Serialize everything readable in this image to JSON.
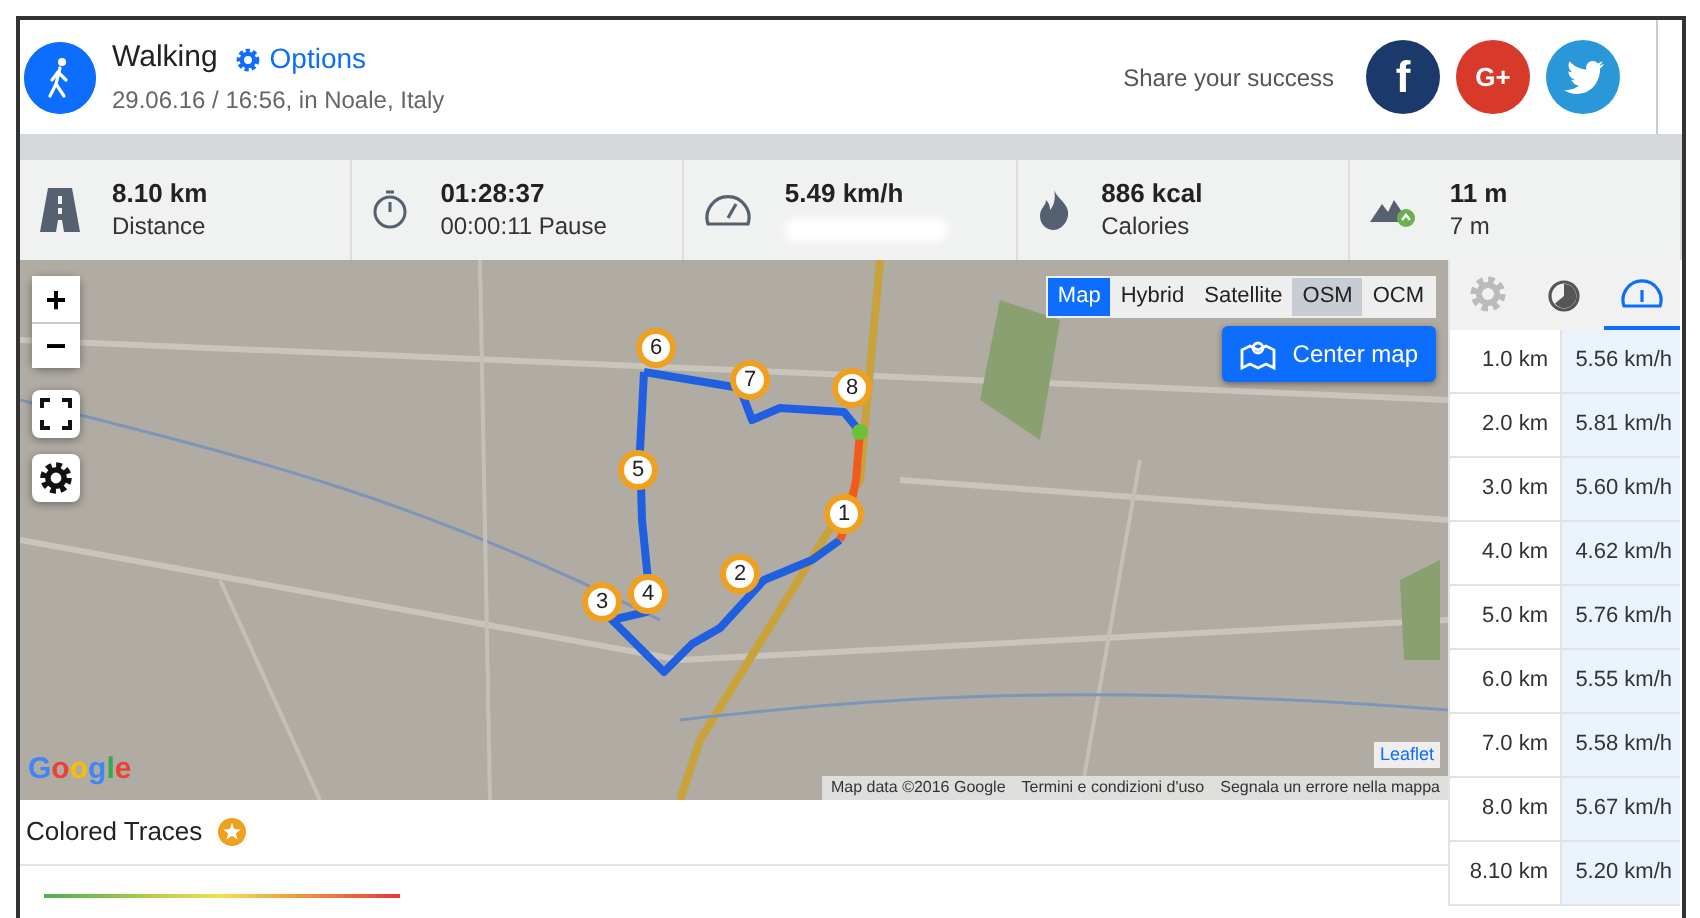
{
  "header": {
    "activity": "Walking",
    "options": "Options",
    "subtitle": "29.06.16 / 16:56, in Noale, Italy",
    "share_label": "Share your success",
    "share_buttons": [
      {
        "kind": "facebook",
        "label": "f"
      },
      {
        "kind": "google",
        "label": "G+"
      },
      {
        "kind": "twitter"
      }
    ]
  },
  "stats": [
    {
      "kind": "distance",
      "value": "8.10 km",
      "label": "Distance"
    },
    {
      "kind": "duration",
      "value": "01:28:37",
      "label": "00:00:11 Pause"
    },
    {
      "kind": "speed",
      "value": "5.49 km/h"
    },
    {
      "kind": "calories",
      "value": "886 kcal",
      "label": "Calories"
    },
    {
      "kind": "elevation",
      "value": "11 m",
      "label": "7 m"
    }
  ],
  "map": {
    "zoom_in": "+",
    "zoom_out": "−",
    "layers": [
      {
        "label": "Map",
        "selected": true,
        "hovered": false
      },
      {
        "label": "Hybrid",
        "selected": false,
        "hovered": false
      },
      {
        "label": "Satellite",
        "selected": false,
        "hovered": false
      },
      {
        "label": "OSM",
        "selected": false,
        "hovered": true
      },
      {
        "label": "OCM",
        "selected": false,
        "hovered": false
      }
    ],
    "center_button": "Center map",
    "markers": [
      "1",
      "2",
      "3",
      "4",
      "5",
      "6",
      "7",
      "8"
    ],
    "logo": "Google",
    "attribution": [
      "Map data ©2016 Google",
      "Termini e condizioni d'uso",
      "Segnala un errore nella mappa"
    ],
    "leaflet": "Leaflet"
  },
  "split_tabs": [
    {
      "kind": "settings",
      "selected": false
    },
    {
      "kind": "timer",
      "selected": false
    },
    {
      "kind": "speed",
      "selected": true
    }
  ],
  "splits": [
    {
      "distance": "1.0 km",
      "speed": "5.56 km/h"
    },
    {
      "distance": "2.0 km",
      "speed": "5.81 km/h"
    },
    {
      "distance": "3.0 km",
      "speed": "5.60 km/h"
    },
    {
      "distance": "4.0 km",
      "speed": "4.62 km/h"
    },
    {
      "distance": "5.0 km",
      "speed": "5.76 km/h"
    },
    {
      "distance": "6.0 km",
      "speed": "5.55 km/h"
    },
    {
      "distance": "7.0 km",
      "speed": "5.58 km/h"
    },
    {
      "distance": "8.0 km",
      "speed": "5.67 km/h"
    },
    {
      "distance": "8.10 km",
      "speed": "5.20 km/h"
    }
  ],
  "traces": {
    "title": "Colored Traces"
  }
}
